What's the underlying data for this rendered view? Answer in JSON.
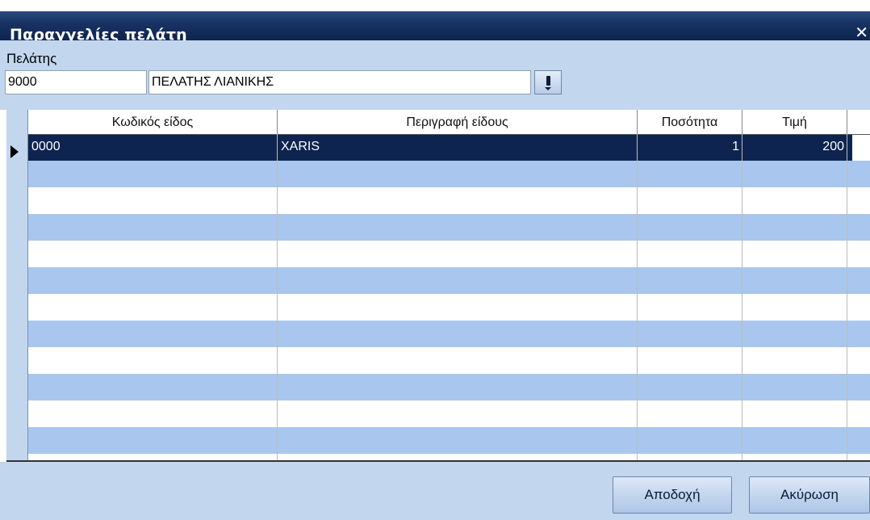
{
  "window": {
    "title": "Παραγγελίες πελάτη",
    "close_symbol": "✕",
    "close_icon": "close-icon"
  },
  "customer": {
    "label": "Πελάτης",
    "code_value": "9000",
    "name_value": "ΠΕΛΑΤΗΣ ΛΙΑΝΙΚΗΣ",
    "lookup_icon": "lookup-dropdown-icon"
  },
  "grid": {
    "columns": [
      "Κωδικός είδος",
      "Περιγραφή είδους",
      "Ποσότητα",
      "Τιμή"
    ],
    "rows": [
      {
        "code": "0000",
        "description": "XARIS",
        "quantity": "1",
        "price": "200",
        "selected": true
      }
    ],
    "empty_row_count": 11,
    "current_row_icon": "row-pointer-icon"
  },
  "buttons": {
    "accept_label": "Αποδοχή",
    "cancel_label": "Ακύρωση"
  },
  "colors": {
    "title_bar": "#0e2450",
    "selection": "#0e2450",
    "band": "#a9c7ee",
    "panel": "#c2d7ee"
  }
}
